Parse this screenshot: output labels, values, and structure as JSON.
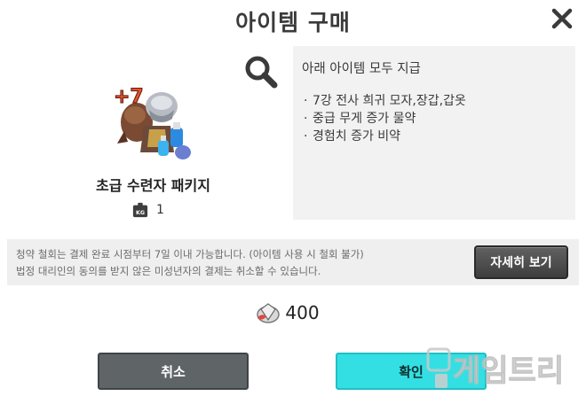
{
  "dialog": {
    "title": "아이템 구매",
    "close_icon": "close-icon"
  },
  "item": {
    "name": "초급 수련자 패키지",
    "weight_badge": "KG",
    "quantity": "1",
    "art_icon": "item-bundle-icon"
  },
  "description": {
    "heading": "아래 아이템 모두 지급",
    "bullet": "·",
    "items": [
      "7강 전사 희귀 모자,장갑,갑옷",
      "중급 무게 증가 물약",
      "경험치 증가 비약"
    ]
  },
  "notice": {
    "lines": [
      "청약 철회는 결제 완료 시점부터 7일 이내 가능합니다. (아이템 사용 시 철회 불가)",
      "법정 대리인의 동의를 받지 않은 미성년자의 결제는 취소할 수 있습니다."
    ],
    "detail_button": "자세히 보기"
  },
  "price": {
    "amount": "400",
    "currency_icon": "diamond-coin-icon"
  },
  "buttons": {
    "cancel": "취소",
    "confirm": "확인"
  },
  "watermark": {
    "text": "게임트리"
  },
  "colors": {
    "confirm": "#34dfe3",
    "cancel": "#5f6466",
    "detail": "#4a4a4a",
    "panel": "#f2f2f2"
  }
}
